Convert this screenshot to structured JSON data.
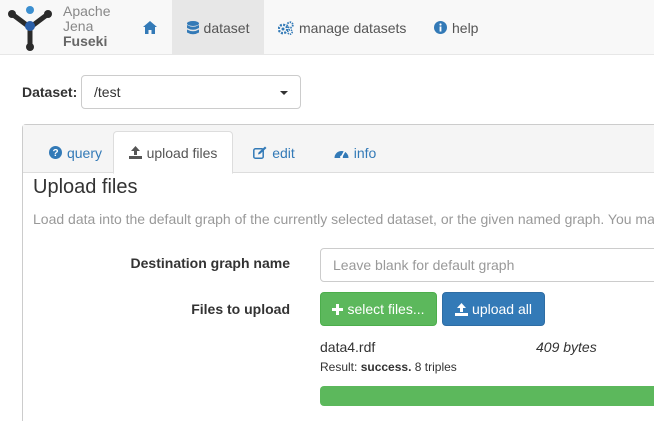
{
  "brand": {
    "line1": "Apache",
    "line2": "Jena",
    "line3": "Fuseki"
  },
  "nav": {
    "home_icon": "home-icon",
    "dataset_label": "dataset",
    "manage_label": "manage datasets",
    "help_label": "help"
  },
  "dataset_selector": {
    "label": "Dataset:",
    "selected": "/test"
  },
  "tabs": [
    {
      "label": "query",
      "icon": "question-circle-icon"
    },
    {
      "label": "upload files",
      "icon": "upload-icon"
    },
    {
      "label": "edit",
      "icon": "edit-icon"
    },
    {
      "label": "info",
      "icon": "dashboard-icon"
    }
  ],
  "upload": {
    "title": "Upload files",
    "description": "Load data into the default graph of the currently selected dataset, or the given named graph. You ma",
    "dest_label": "Destination graph name",
    "dest_placeholder": "Leave blank for default graph",
    "files_label": "Files to upload",
    "select_button": "select files...",
    "upload_button": "upload all",
    "file": {
      "name": "data4.rdf",
      "size": "409 bytes",
      "result_prefix": "Result:",
      "result_status": "success.",
      "result_detail": "8 triples",
      "progress_fraction": 1.0
    }
  },
  "colors": {
    "primary": "#337ab7",
    "success": "#5cb85c",
    "navbar_bg": "#f8f8f8"
  }
}
